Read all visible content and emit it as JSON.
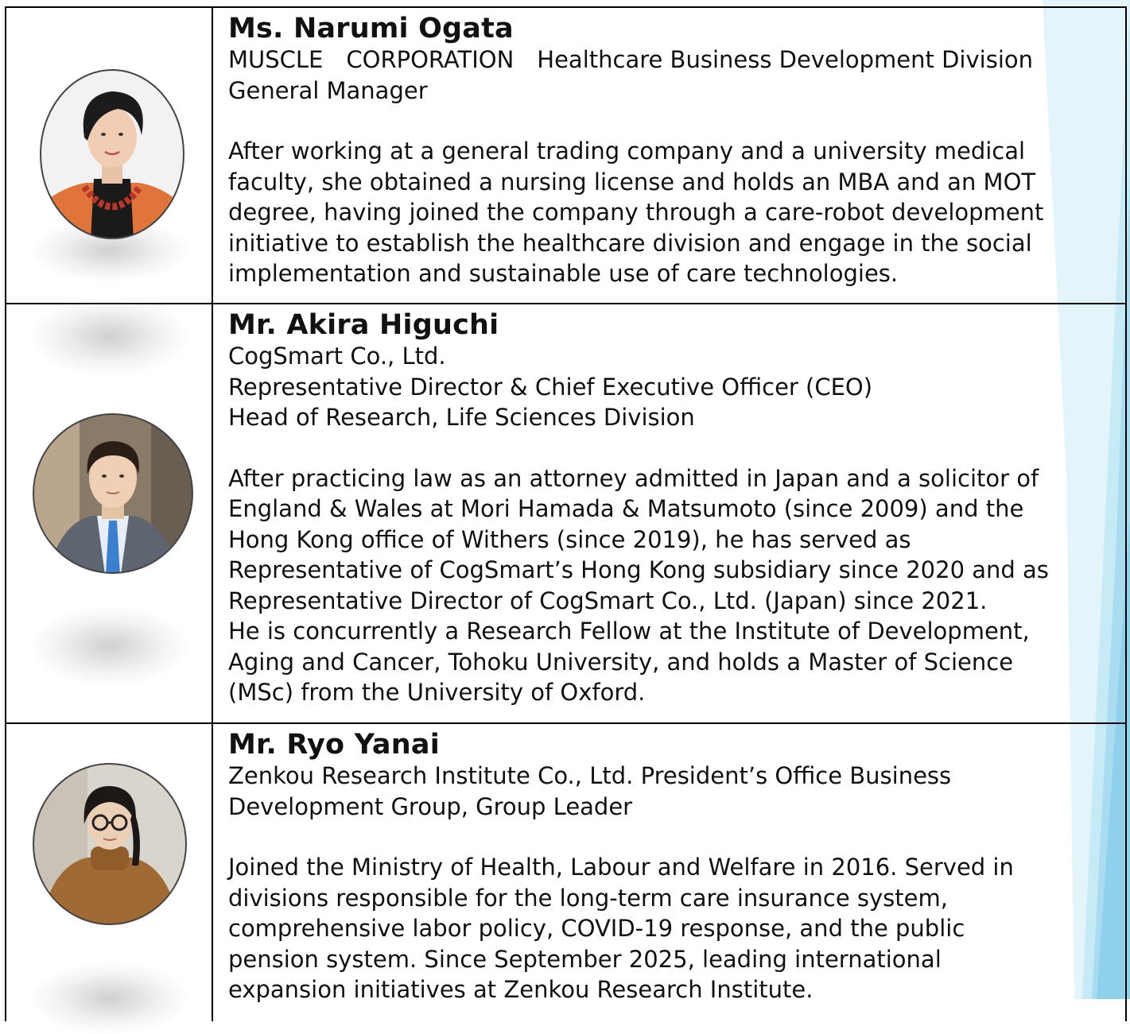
{
  "colors": {
    "ribbon_light": "#dff3fb",
    "ribbon_mid": "#bfe6f5",
    "ribbon_dark": "#8fd1ec",
    "border": "#000000"
  },
  "speakers": [
    {
      "name": "Ms. Narumi Ogata",
      "affiliation_lines": [
        "MUSCLE　CORPORATION　Healthcare Business Development Division",
        "General Manager"
      ],
      "bio_lines": [
        "After working at a general trading company and a university medical",
        "faculty, she obtained a nursing license and holds an MBA and an MOT",
        "degree, having joined the company through a care-robot development",
        "initiative to establish the healthcare division and engage in the social",
        "implementation and sustainable use of care technologies."
      ],
      "photo_icon": "woman-portrait-icon"
    },
    {
      "name": "Mr. Akira Higuchi",
      "affiliation_lines": [
        "CogSmart Co., Ltd.",
        "Representative Director & Chief Executive Officer (CEO)",
        "Head of Research, Life Sciences Division"
      ],
      "bio_lines": [
        "After practicing law as an attorney admitted in Japan and a solicitor of",
        "England & Wales at Mori Hamada & Matsumoto (since 2009) and the",
        "Hong Kong office of Withers (since 2019), he has served as",
        "Representative of CogSmart’s Hong Kong subsidiary since 2020 and as",
        "Representative Director of CogSmart Co., Ltd. (Japan) since 2021.",
        "He is concurrently a Research Fellow at the Institute of Development,",
        "Aging and Cancer, Tohoku University, and holds a Master of Science",
        "(MSc) from the University of Oxford."
      ],
      "photo_icon": "man-in-suit-portrait-icon"
    },
    {
      "name": "Mr. Ryo Yanai",
      "affiliation_lines": [
        "Zenkou Research Institute Co., Ltd. President’s Office Business",
        "Development Group, Group Leader"
      ],
      "bio_lines": [
        "Joined the Ministry of Health, Labour and Welfare in 2016. Served in",
        "divisions responsible for the long-term care insurance system,",
        "comprehensive labor policy, COVID-19 response, and the public",
        "pension system. Since September 2025, leading international",
        "expansion initiatives at Zenkou Research Institute."
      ],
      "photo_icon": "man-with-glasses-portrait-icon"
    }
  ]
}
